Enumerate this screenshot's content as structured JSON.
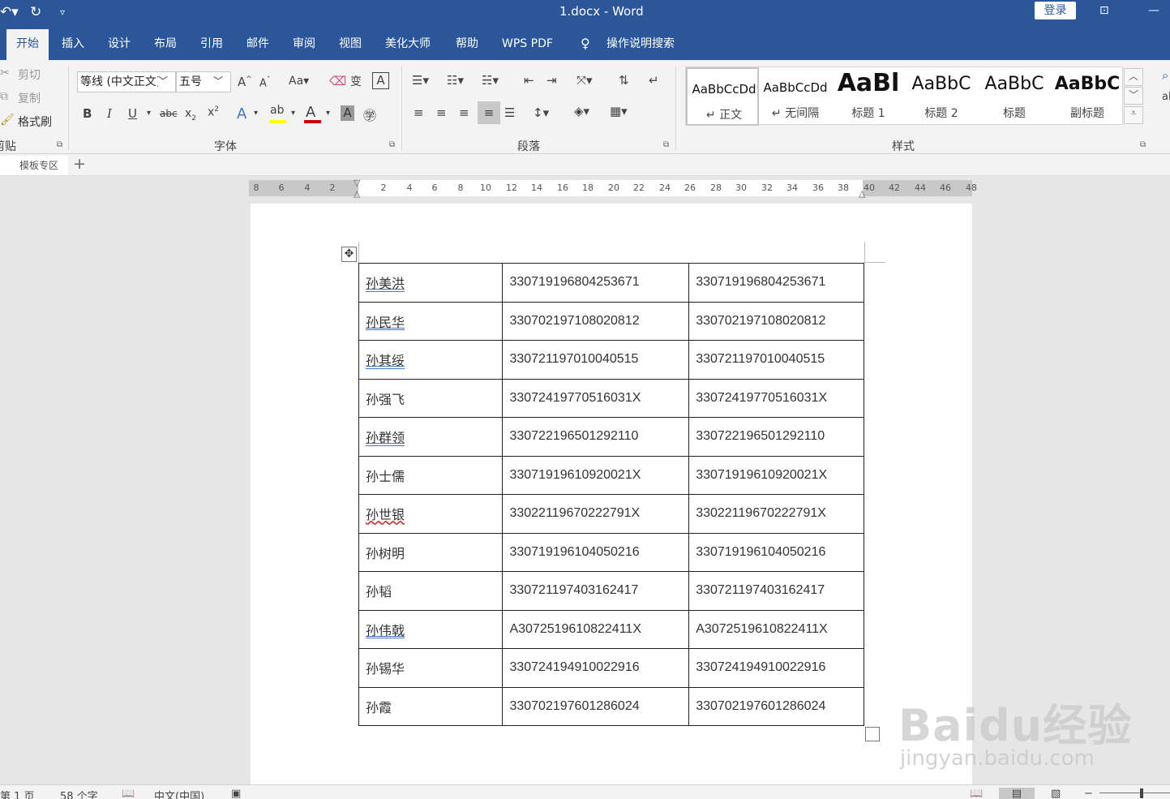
{
  "titlebar": {
    "title": "1.docx  -  Word",
    "login": "登录",
    "undo_icon": "undo-icon",
    "redo_icon": "redo-icon"
  },
  "tabs": [
    "开始",
    "插入",
    "设计",
    "布局",
    "引用",
    "邮件",
    "审阅",
    "视图",
    "美化大师",
    "帮助",
    "WPS PDF"
  ],
  "search_hint": "操作说明搜索",
  "clipboard": {
    "cut": "剪切",
    "copy": "复制",
    "format_painter": "格式刷",
    "group_label": "剪贴板"
  },
  "font": {
    "family": "等线 (中文正文)",
    "size": "五号",
    "change_case": "Aa",
    "group_label": "字体",
    "bold": "B",
    "italic": "I",
    "underline": "U",
    "strike": "abc",
    "font_color": "#d00000",
    "highlight_color": "#ffff00"
  },
  "paragraph": {
    "group_label": "段落"
  },
  "styles": {
    "group_label": "样式",
    "items": [
      {
        "sample": "AaBbCcDd",
        "name": "↵ 正文"
      },
      {
        "sample": "AaBbCcDd",
        "name": "↵ 无间隔"
      },
      {
        "sample": "AaBl",
        "name": "标题 1"
      },
      {
        "sample": "AaBbC",
        "name": "标题 2"
      },
      {
        "sample": "AaBbC",
        "name": "标题"
      },
      {
        "sample": "AaBbC",
        "name": "副标题"
      }
    ]
  },
  "template_tab": "模板专区",
  "ruler": {
    "left": [
      "8",
      "6",
      "4",
      "2"
    ],
    "right": [
      "2",
      "4",
      "6",
      "8",
      "10",
      "12",
      "14",
      "16",
      "18",
      "20",
      "22",
      "24",
      "26",
      "28",
      "30",
      "32",
      "34",
      "36",
      "38",
      "40",
      "42",
      "44",
      "46",
      "48"
    ]
  },
  "table": {
    "rows": [
      [
        "孙美洪",
        "330719196804253671",
        "330719196804253671"
      ],
      [
        "孙民华",
        "330702197108020812",
        "330702197108020812"
      ],
      [
        "孙其绥",
        "330721197010040515",
        "330721197010040515"
      ],
      [
        "孙强飞",
        "33072419770516031X",
        "33072419770516031X"
      ],
      [
        "孙群领",
        "330722196501292110",
        "330722196501292110"
      ],
      [
        "孙士儒",
        "33071919610920021X",
        "33071919610920021X"
      ],
      [
        "孙世银",
        "33022119670222791X",
        "33022119670222791X"
      ],
      [
        "孙树明",
        "330719196104050216",
        "330719196104050216"
      ],
      [
        "孙韬",
        "330721197403162417",
        "330721197403162417"
      ],
      [
        "孙伟戟",
        "A3072519610822411X",
        "A3072519610822411X"
      ],
      [
        "孙锡华",
        "330724194910022916",
        "330724194910022916"
      ],
      [
        "孙霞",
        "330702197601286024",
        "330702197601286024"
      ]
    ],
    "underline_blue": [
      0,
      1,
      2,
      4,
      9
    ],
    "underline_red": [
      6
    ]
  },
  "watermark": {
    "main": "Baidu经验",
    "sub": "jingyan.baidu.com"
  },
  "status": {
    "page": "第 1 页",
    "words": "58 个字",
    "language": "中文(中国)"
  }
}
